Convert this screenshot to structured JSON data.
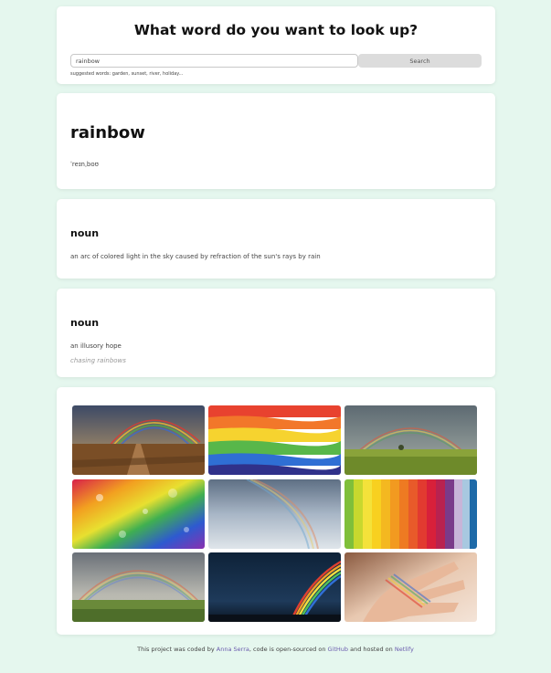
{
  "search": {
    "title": "What word do you want to look up?",
    "input_value": "rainbow",
    "button_label": "Search",
    "suggested": "suggested words: garden, sunset, river, holiday..."
  },
  "entry": {
    "word": "rainbow",
    "phonetic": "ˈreɪnˌboʊ"
  },
  "meanings": [
    {
      "part_of_speech": "noun",
      "definition": "an arc of colored light in the sky caused by refraction of the sun's rays by rain",
      "example": ""
    },
    {
      "part_of_speech": "noun",
      "definition": "an illusory hope",
      "example": "chasing rainbows"
    }
  ],
  "photos": [
    "rainbow-over-boardwalk-photo",
    "rainbow-painted-stripes-photo",
    "rainbow-over-field-photo",
    "rainbow-glitter-photo",
    "faint-rainbow-sky-photo",
    "rainbow-paper-strips-photo",
    "double-rainbow-meadow-photo",
    "rainbow-night-sky-photo",
    "rainbow-on-hand-photo"
  ],
  "footer": {
    "prefix": "This project was coded by",
    "author": "Anna Serra",
    "middle": ", code is open-sourced on",
    "github": "GitHub",
    "and_hosted": "and hosted on",
    "netlify": "Netlify"
  },
  "colors": {
    "background": "#e5f7ee",
    "link": "#6b5cae",
    "button": "#dcdcdc"
  }
}
